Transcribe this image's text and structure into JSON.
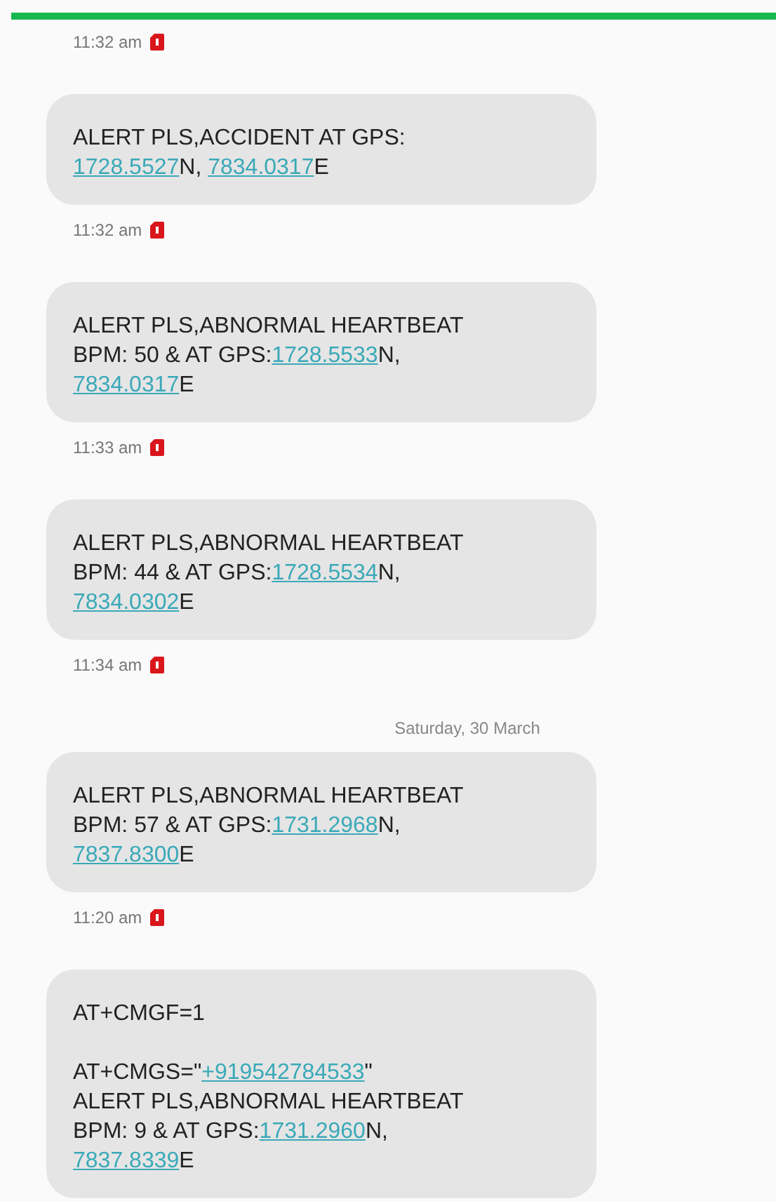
{
  "items": [
    {
      "kind": "time",
      "text": "11:32 am"
    },
    {
      "kind": "message",
      "parts": [
        {
          "kind": "text",
          "text": "ALERT PLS,ACCIDENT AT GPS:\n"
        },
        {
          "kind": "link",
          "text": "1728.5527"
        },
        {
          "kind": "text",
          "text": "N, "
        },
        {
          "kind": "link",
          "text": "7834.0317"
        },
        {
          "kind": "text",
          "text": "E"
        }
      ]
    },
    {
      "kind": "time",
      "text": "11:32 am"
    },
    {
      "kind": "message",
      "parts": [
        {
          "kind": "text",
          "text": "ALERT PLS,ABNORMAL HEARTBEAT\nBPM: 50 & AT GPS:"
        },
        {
          "kind": "link",
          "text": "1728.5533"
        },
        {
          "kind": "text",
          "text": "N,\n"
        },
        {
          "kind": "link",
          "text": "7834.0317"
        },
        {
          "kind": "text",
          "text": "E"
        }
      ]
    },
    {
      "kind": "time",
      "text": "11:33 am"
    },
    {
      "kind": "message",
      "parts": [
        {
          "kind": "text",
          "text": "ALERT PLS,ABNORMAL HEARTBEAT\nBPM: 44 & AT GPS:"
        },
        {
          "kind": "link",
          "text": "1728.5534"
        },
        {
          "kind": "text",
          "text": "N,\n"
        },
        {
          "kind": "link",
          "text": "7834.0302"
        },
        {
          "kind": "text",
          "text": "E"
        }
      ]
    },
    {
      "kind": "time",
      "text": "11:34 am"
    },
    {
      "kind": "date",
      "text": "Saturday, 30 March"
    },
    {
      "kind": "message",
      "parts": [
        {
          "kind": "text",
          "text": "ALERT PLS,ABNORMAL HEARTBEAT\nBPM: 57 & AT GPS:"
        },
        {
          "kind": "link",
          "text": "1731.2968"
        },
        {
          "kind": "text",
          "text": "N,\n"
        },
        {
          "kind": "link",
          "text": "7837.8300"
        },
        {
          "kind": "text",
          "text": "E"
        }
      ]
    },
    {
      "kind": "time",
      "text": "11:20 am"
    },
    {
      "kind": "message",
      "parts": [
        {
          "kind": "text",
          "text": "AT+CMGF=1\n\nAT+CMGS=\""
        },
        {
          "kind": "link",
          "text": "+919542784533"
        },
        {
          "kind": "text",
          "text": "\"\nALERT PLS,ABNORMAL HEARTBEAT\nBPM: 9 & AT GPS:"
        },
        {
          "kind": "link",
          "text": "1731.2960"
        },
        {
          "kind": "text",
          "text": "N,\n"
        },
        {
          "kind": "link",
          "text": "7837.8339"
        },
        {
          "kind": "text",
          "text": "E"
        }
      ]
    }
  ]
}
